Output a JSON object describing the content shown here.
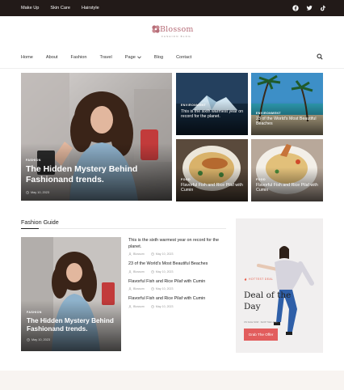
{
  "topbar": {
    "nav": [
      "Make Up",
      "Skin Care",
      "Hairstyle"
    ],
    "social": [
      "facebook-icon",
      "twitter-icon",
      "tiktok-icon"
    ]
  },
  "brand": {
    "name": "Blossom",
    "tagline": "FASHION BLOG"
  },
  "nav": {
    "items": [
      {
        "label": "Home"
      },
      {
        "label": "About"
      },
      {
        "label": "Fashion"
      },
      {
        "label": "Travel"
      },
      {
        "label": "Page",
        "dropdown": true
      },
      {
        "label": "Blog"
      },
      {
        "label": "Contact"
      }
    ]
  },
  "hero": {
    "main": {
      "category": "FASHION",
      "title": "The Hidden Mystery Behind Fashionand trends.",
      "date": "May 10, 2023"
    },
    "cards": [
      {
        "category": "ENVIRONMENT",
        "title": "This is the sixth warmest year on record for the planet."
      },
      {
        "category": "ENVIRONMENT",
        "title": "23 of the World's Most Beautiful Beaches"
      },
      {
        "category": "FOOD",
        "title": "Flavorful Fish and Rice Pilaf with Cumin"
      },
      {
        "category": "FOOD",
        "title": "Flavorful Fish and Rice Pilaf with Cumin"
      }
    ]
  },
  "guide": {
    "title": "Fashion Guide",
    "feature": {
      "category": "FASHION",
      "title": "The Hidden Mystery Behind Fashionand trends.",
      "date": "May 10, 2023"
    },
    "list": [
      {
        "title": "This is the sixth warmest year on record for the planet.",
        "author": "Blossom",
        "date": "May 10, 2023"
      },
      {
        "title": "23 of the World's Most Beautiful Beaches",
        "author": "Blossom",
        "date": "May 10, 2023"
      },
      {
        "title": "Flavorful Fish and Rice Pilaf with Cumin",
        "author": "Blossom",
        "date": "May 10, 2023"
      },
      {
        "title": "Flavorful Fish and Rice Pilaf with Cumin",
        "author": "Blossom",
        "date": "May 10, 2023"
      }
    ]
  },
  "promo": {
    "kicker": "HOTTEST DEAL",
    "title": "Deal of the Day",
    "subtitle": "ON SALE NOW · SHOP THE LOOK",
    "button": "Grab The Offer"
  },
  "colors": {
    "topbar": "#221a18",
    "brand": "#b76e79",
    "accent": "#e25d5d",
    "promo_bg": "#f1efef"
  }
}
